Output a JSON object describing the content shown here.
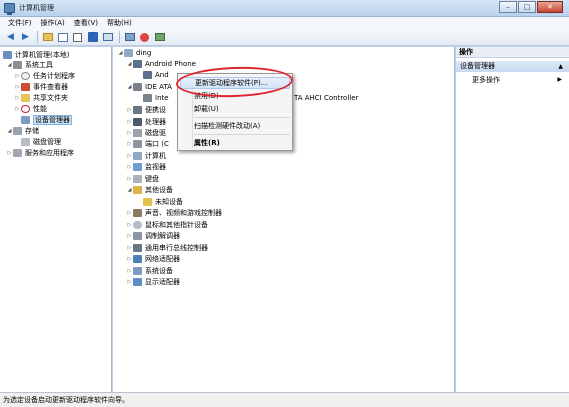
{
  "window": {
    "title": "计算机管理",
    "minimize_glyph": "–",
    "maximize_glyph": "□",
    "close_glyph": "✕"
  },
  "menubar": [
    {
      "label": "文件(F)"
    },
    {
      "label": "操作(A)"
    },
    {
      "label": "查看(V)"
    },
    {
      "label": "帮助(H)"
    }
  ],
  "toolbar": {
    "back_glyph": "◀",
    "forward_glyph": "▶"
  },
  "nav_tree": {
    "root": "计算机管理(本地)",
    "system_tools": "系统工具",
    "task_scheduler": "任务计划程序",
    "event_viewer": "事件查看器",
    "shared_folders": "共享文件夹",
    "performance": "性能",
    "device_manager": "设备管理器",
    "storage": "存储",
    "disk_management": "磁盘管理",
    "services_apps": "服务和应用程序"
  },
  "device_tree": {
    "computer": "ding",
    "android_phone": "Android Phone",
    "android_child": "And",
    "ide_ata": "IDE ATA",
    "ide_child_prefix": "Inte",
    "ide_child_suffix": "TA AHCI Controller",
    "portable": "便携设",
    "processor": "处理器",
    "disk_drive": "磁盘驱",
    "ports": "端口 (C",
    "computer_node": "计算机",
    "monitor": "监视器",
    "keyboard": "键盘",
    "other_devices": "其他设备",
    "unknown_device": "未知设备",
    "sound": "声音、视频和游戏控制器",
    "mouse": "鼠标和其他指针设备",
    "modem": "调制解调器",
    "usb": "通用串行总线控制器",
    "network": "网络适配器",
    "system_devices": "系统设备",
    "display": "显示适配器"
  },
  "context_menu": {
    "update_driver": "更新驱动程序软件(P)...",
    "disable": "禁用(D)",
    "uninstall": "卸载(U)",
    "scan": "扫描检测硬件改动(A)",
    "properties": "属性(R)"
  },
  "actions": {
    "header": "操作",
    "section": "设备管理器",
    "more": "更多操作",
    "collapse_glyph": "▲",
    "expand_glyph": "▶"
  },
  "status": {
    "text": "为选定设备启动更新驱动程序软件向导。"
  },
  "colors": {
    "highlight_ellipse": "#e2242c",
    "selection": "#cce4f7"
  }
}
